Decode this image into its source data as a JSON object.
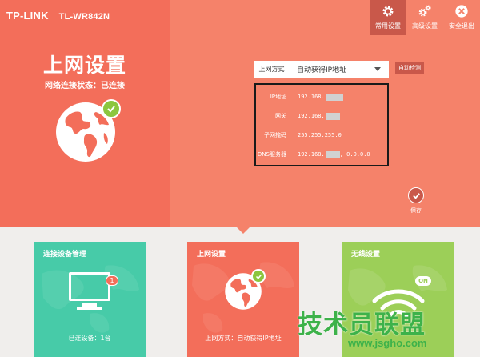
{
  "brand": {
    "logo": "TP-LINK",
    "model": "TL-WR842N"
  },
  "toolbar": {
    "items": [
      {
        "label": "常用设置",
        "icon": "gear-icon",
        "active": true
      },
      {
        "label": "高级设置",
        "icon": "gears-icon",
        "active": false
      },
      {
        "label": "安全退出",
        "icon": "exit-icon",
        "active": false
      }
    ]
  },
  "page": {
    "title": "上网设置",
    "status_text": "网络连接状态：已连接"
  },
  "form": {
    "mode_label": "上网方式",
    "mode_value": "自动获得IP地址",
    "auto_detect_label": "自动检测",
    "fields": [
      {
        "label": "IP地址",
        "value": "192.168.",
        "suffix": ""
      },
      {
        "label": "网关",
        "value": "192.168.",
        "suffix": ""
      },
      {
        "label": "子网掩码",
        "value": "255.255.255.0",
        "suffix": ""
      },
      {
        "label": "DNS服务器",
        "value": "192.168.",
        "suffix": ", 0.0.0.0"
      }
    ],
    "save_label": "保存"
  },
  "cards": [
    {
      "title": "连接设备管理",
      "footer": "已连设备：1台",
      "badge": "1",
      "color": "#47cba8"
    },
    {
      "title": "上网设置",
      "footer": "上网方式：自动获得IP地址",
      "color": "#f36e5a"
    },
    {
      "title": "无线设置",
      "footer": "",
      "badge": "ON",
      "color": "#9ccf58"
    }
  ],
  "watermark": {
    "main": "技术员联盟",
    "url": "www.jsgho.com"
  },
  "colors": {
    "primary": "#f36e5a",
    "accent": "#c9584a",
    "green": "#8cc63f",
    "teal": "#47cba8",
    "lime": "#9ccf58"
  }
}
